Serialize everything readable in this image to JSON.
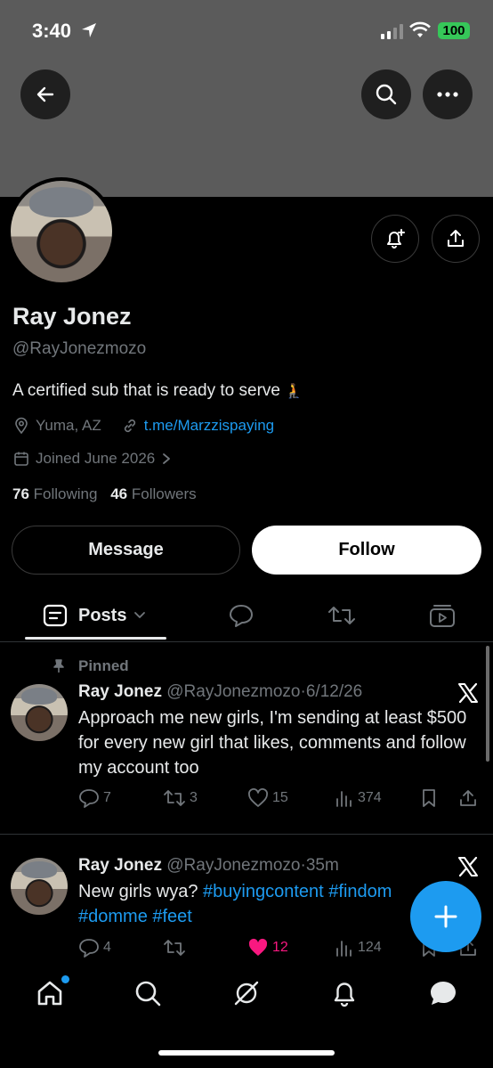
{
  "status_bar": {
    "time": "3:40",
    "battery": "100"
  },
  "profile": {
    "name": "Ray Jonez",
    "handle": "@RayJonezmozo",
    "bio": "A certified sub that is ready to serve",
    "bio_emoji": "🧎",
    "location": "Yuma, AZ",
    "link": "t.me/Marzzispaying",
    "joined": "Joined June 2026",
    "following_count": "76",
    "following_label": "Following",
    "followers_count": "46",
    "followers_label": "Followers"
  },
  "buttons": {
    "message": "Message",
    "follow": "Follow"
  },
  "tabs": {
    "posts": "Posts"
  },
  "posts": [
    {
      "pinned_label": "Pinned",
      "name": "Ray Jonez",
      "handle": "@RayJonezmozo",
      "sep": "·",
      "time": "6/12/26",
      "text": "Approach me new girls, I'm sending at least $500 for every new girl that likes, comments and follow my account too",
      "replies": "7",
      "reposts": "3",
      "likes": "15",
      "views": "374"
    },
    {
      "name": "Ray Jonez",
      "handle": "@RayJonezmozo",
      "sep": "·",
      "time": "35m",
      "text_plain": "New girls wya? ",
      "hashtags": [
        "#buyingcontent",
        "#findom",
        "#domme",
        "#feet"
      ],
      "replies": "4",
      "reposts": "",
      "likes": "12",
      "views": "124"
    }
  ],
  "colors": {
    "accent": "#1d9bf0",
    "like": "#f91880",
    "banner": "#5b5b5b",
    "battery": "#36c759"
  }
}
